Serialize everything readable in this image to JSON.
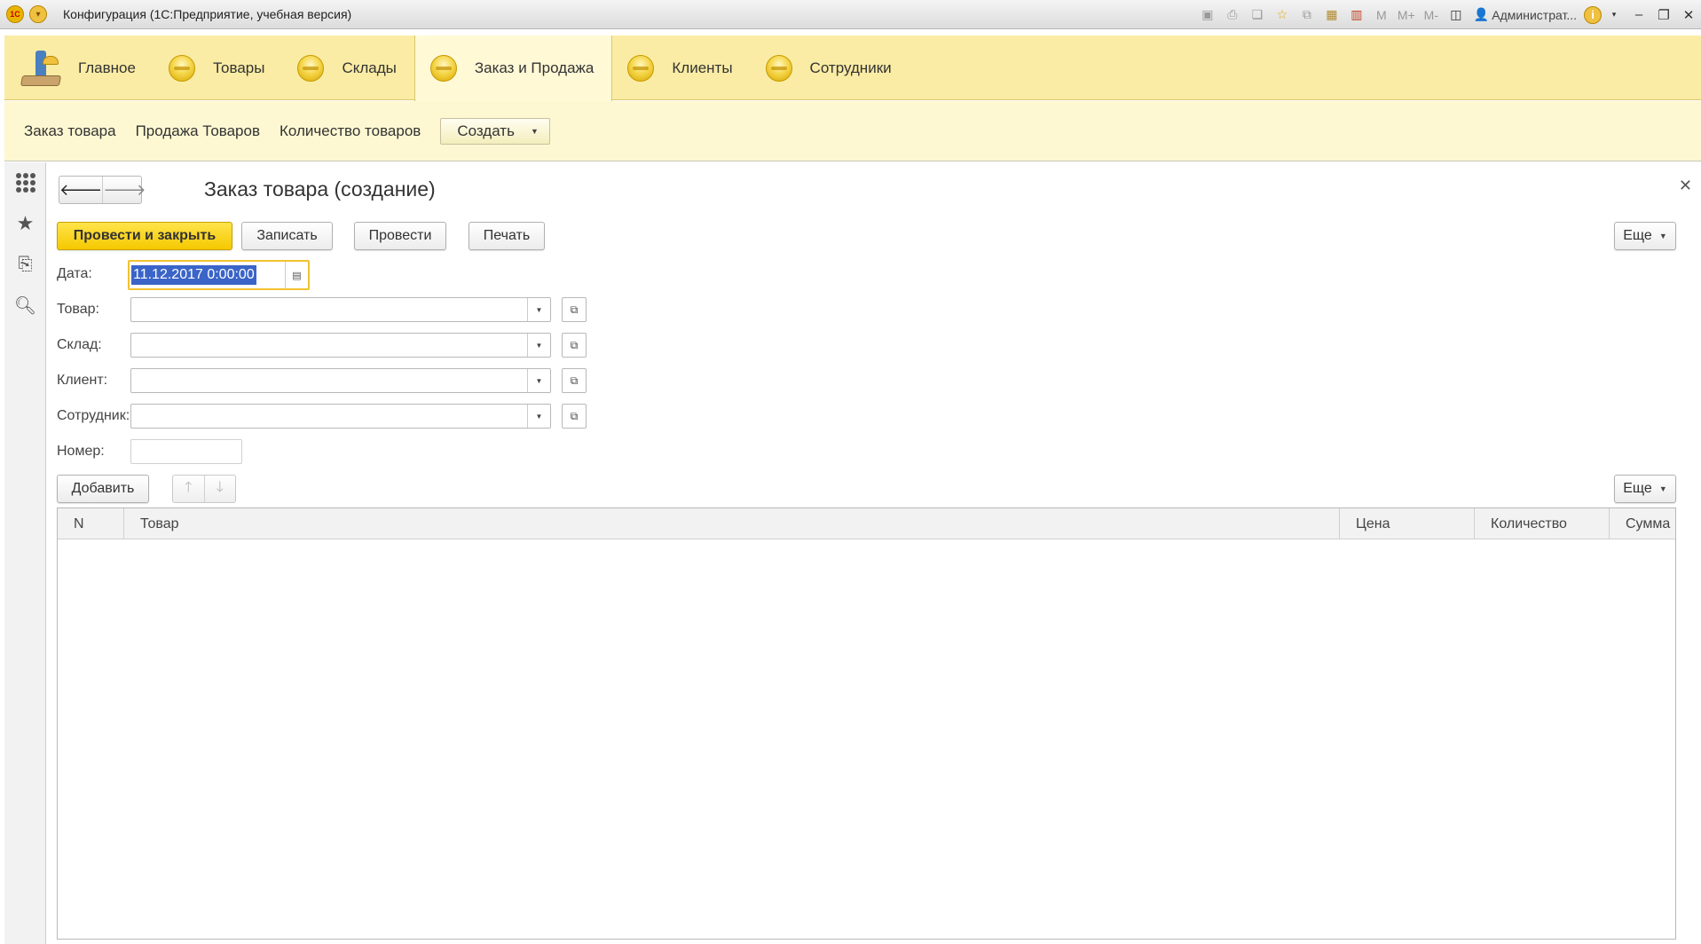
{
  "titlebar": {
    "logo": "1C",
    "title": "Конфигурация (1С:Предприятие, учебная версия)",
    "user": "Администрат...",
    "memory": [
      "M",
      "M+",
      "M-"
    ]
  },
  "sections": [
    {
      "label": "Главное",
      "icon": "home-desk-icon"
    },
    {
      "label": "Товары",
      "icon": "section-ball-icon"
    },
    {
      "label": "Склады",
      "icon": "section-ball-icon"
    },
    {
      "label": "Заказ и Продажа",
      "icon": "section-ball-icon",
      "active": true
    },
    {
      "label": "Клиенты",
      "icon": "section-ball-icon"
    },
    {
      "label": "Сотрудники",
      "icon": "section-ball-icon"
    }
  ],
  "nav": {
    "links": [
      "Заказ товара",
      "Продажа Товаров",
      "Количество товаров"
    ],
    "create_label": "Создать"
  },
  "form": {
    "title": "Заказ товара (создание)",
    "buttons": {
      "post_close": "Провести и закрыть",
      "save": "Записать",
      "post": "Провести",
      "print": "Печать",
      "more": "Еще"
    },
    "fields": {
      "date_label": "Дата:",
      "date_value": "11.12.2017  0:00:00",
      "product_label": "Товар:",
      "warehouse_label": "Склад:",
      "client_label": "Клиент:",
      "employee_label": "Сотрудник:",
      "number_label": "Номер:"
    },
    "table_toolbar": {
      "add": "Добавить",
      "more": "Еще"
    },
    "table": {
      "columns": [
        "N",
        "Товар",
        "Цена",
        "Количество",
        "Сумма"
      ]
    }
  },
  "colors": {
    "sections_bg": "#faeca4",
    "nav_bg": "#fdf8d2",
    "primary_button": "#f5c800",
    "selection": "#3a64c8"
  }
}
